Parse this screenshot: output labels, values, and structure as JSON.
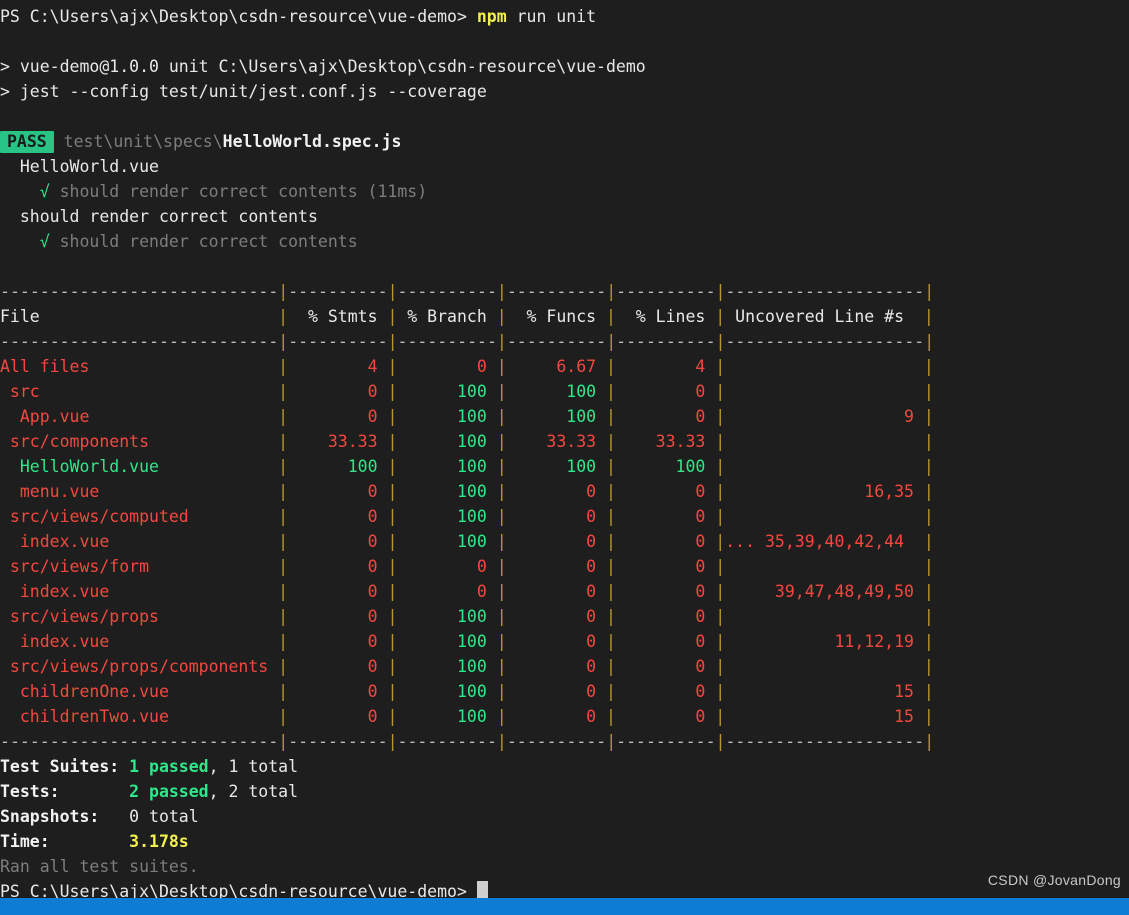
{
  "terminal": {
    "prompt_line_1": "PS C:\\Users\\ajx\\Desktop\\csdn-resource\\vue-demo> ",
    "command": "npm",
    "command_args": " run unit",
    "script_line_1": "> vue-demo@1.0.0 unit C:\\Users\\ajx\\Desktop\\csdn-resource\\vue-demo",
    "script_line_2": "> jest --config test/unit/jest.conf.js --coverage",
    "pass_badge": "PASS",
    "spec_path_dim": " test\\unit\\specs\\",
    "spec_file": "HelloWorld.spec.js",
    "suite_name": "  HelloWorld.vue",
    "test_1_check": "    √ ",
    "test_1_label": "should render correct contents",
    "test_1_time": " (11ms)",
    "suite_name_2": "  should render correct contents",
    "test_2_check": "    √ ",
    "test_2_label": "should render correct contents",
    "final_prompt": "PS C:\\Users\\ajx\\Desktop\\csdn-resource\\vue-demo> "
  },
  "coverage_table": {
    "separator": "----------------------------|----------|----------|----------|----------|--------------------|",
    "headers": {
      "file": "File",
      "stmts": "% Stmts",
      "branch": "% Branch",
      "funcs": "% Funcs",
      "lines": "% Lines",
      "uncovered": "Uncovered Line #s"
    },
    "rows": [
      {
        "file": "All files",
        "indent": 0,
        "file_color": "red",
        "stmts": "4",
        "stmts_color": "red",
        "branch": "0",
        "branch_color": "red",
        "funcs": "6.67",
        "funcs_color": "red",
        "lines": "4",
        "lines_color": "red",
        "uncovered": ""
      },
      {
        "file": "src",
        "indent": 1,
        "file_color": "red",
        "stmts": "0",
        "stmts_color": "red",
        "branch": "100",
        "branch_color": "green",
        "funcs": "100",
        "funcs_color": "green",
        "lines": "0",
        "lines_color": "red",
        "uncovered": ""
      },
      {
        "file": "App.vue",
        "indent": 2,
        "file_color": "red",
        "stmts": "0",
        "stmts_color": "red",
        "branch": "100",
        "branch_color": "green",
        "funcs": "100",
        "funcs_color": "green",
        "lines": "0",
        "lines_color": "red",
        "uncovered": "9"
      },
      {
        "file": "src/components",
        "indent": 1,
        "file_color": "red",
        "stmts": "33.33",
        "stmts_color": "red",
        "branch": "100",
        "branch_color": "green",
        "funcs": "33.33",
        "funcs_color": "red",
        "lines": "33.33",
        "lines_color": "red",
        "uncovered": ""
      },
      {
        "file": "HelloWorld.vue",
        "indent": 2,
        "file_color": "green",
        "stmts": "100",
        "stmts_color": "green",
        "branch": "100",
        "branch_color": "green",
        "funcs": "100",
        "funcs_color": "green",
        "lines": "100",
        "lines_color": "green",
        "uncovered": ""
      },
      {
        "file": "menu.vue",
        "indent": 2,
        "file_color": "red",
        "stmts": "0",
        "stmts_color": "red",
        "branch": "100",
        "branch_color": "green",
        "funcs": "0",
        "funcs_color": "red",
        "lines": "0",
        "lines_color": "red",
        "uncovered": "16,35"
      },
      {
        "file": "src/views/computed",
        "indent": 1,
        "file_color": "red",
        "stmts": "0",
        "stmts_color": "red",
        "branch": "100",
        "branch_color": "green",
        "funcs": "0",
        "funcs_color": "red",
        "lines": "0",
        "lines_color": "red",
        "uncovered": ""
      },
      {
        "file": "index.vue",
        "indent": 2,
        "file_color": "red",
        "stmts": "0",
        "stmts_color": "red",
        "branch": "100",
        "branch_color": "green",
        "funcs": "0",
        "funcs_color": "red",
        "lines": "0",
        "lines_color": "red",
        "uncovered": "... 35,39,40,42,44",
        "uncovered_left": true
      },
      {
        "file": "src/views/form",
        "indent": 1,
        "file_color": "red",
        "stmts": "0",
        "stmts_color": "red",
        "branch": "0",
        "branch_color": "red",
        "funcs": "0",
        "funcs_color": "red",
        "lines": "0",
        "lines_color": "red",
        "uncovered": ""
      },
      {
        "file": "index.vue",
        "indent": 2,
        "file_color": "red",
        "stmts": "0",
        "stmts_color": "red",
        "branch": "0",
        "branch_color": "red",
        "funcs": "0",
        "funcs_color": "red",
        "lines": "0",
        "lines_color": "red",
        "uncovered": "39,47,48,49,50"
      },
      {
        "file": "src/views/props",
        "indent": 1,
        "file_color": "red",
        "stmts": "0",
        "stmts_color": "red",
        "branch": "100",
        "branch_color": "green",
        "funcs": "0",
        "funcs_color": "red",
        "lines": "0",
        "lines_color": "red",
        "uncovered": ""
      },
      {
        "file": "index.vue",
        "indent": 2,
        "file_color": "red",
        "stmts": "0",
        "stmts_color": "red",
        "branch": "100",
        "branch_color": "green",
        "funcs": "0",
        "funcs_color": "red",
        "lines": "0",
        "lines_color": "red",
        "uncovered": "11,12,19"
      },
      {
        "file": "src/views/props/components",
        "indent": 1,
        "file_color": "red",
        "stmts": "0",
        "stmts_color": "red",
        "branch": "100",
        "branch_color": "green",
        "funcs": "0",
        "funcs_color": "red",
        "lines": "0",
        "lines_color": "red",
        "uncovered": ""
      },
      {
        "file": "childrenOne.vue",
        "indent": 2,
        "file_color": "red",
        "stmts": "0",
        "stmts_color": "red",
        "branch": "100",
        "branch_color": "green",
        "funcs": "0",
        "funcs_color": "red",
        "lines": "0",
        "lines_color": "red",
        "uncovered": "15"
      },
      {
        "file": "childrenTwo.vue",
        "indent": 2,
        "file_color": "red",
        "stmts": "0",
        "stmts_color": "red",
        "branch": "100",
        "branch_color": "green",
        "funcs": "0",
        "funcs_color": "red",
        "lines": "0",
        "lines_color": "red",
        "uncovered": "15"
      }
    ]
  },
  "summary": {
    "suites_label": "Test Suites: ",
    "suites_passed": "1 passed",
    "suites_total": ", 1 total",
    "tests_label": "Tests:       ",
    "tests_passed": "2 passed",
    "tests_total": ", 2 total",
    "snapshots_label": "Snapshots:   ",
    "snapshots_value": "0 total",
    "time_label": "Time:        ",
    "time_value": "3.178s",
    "ran_all": "Ran all test suites."
  },
  "watermark": "CSDN @JovanDong",
  "colors": {
    "background": "#1e1e1e",
    "red": "#f4483f",
    "green": "#2ee88a",
    "yellow": "#f2f24f",
    "gray": "#7d7d7d",
    "pass_badge_bg": "#27c485",
    "taskbar": "#0c7cd5"
  }
}
